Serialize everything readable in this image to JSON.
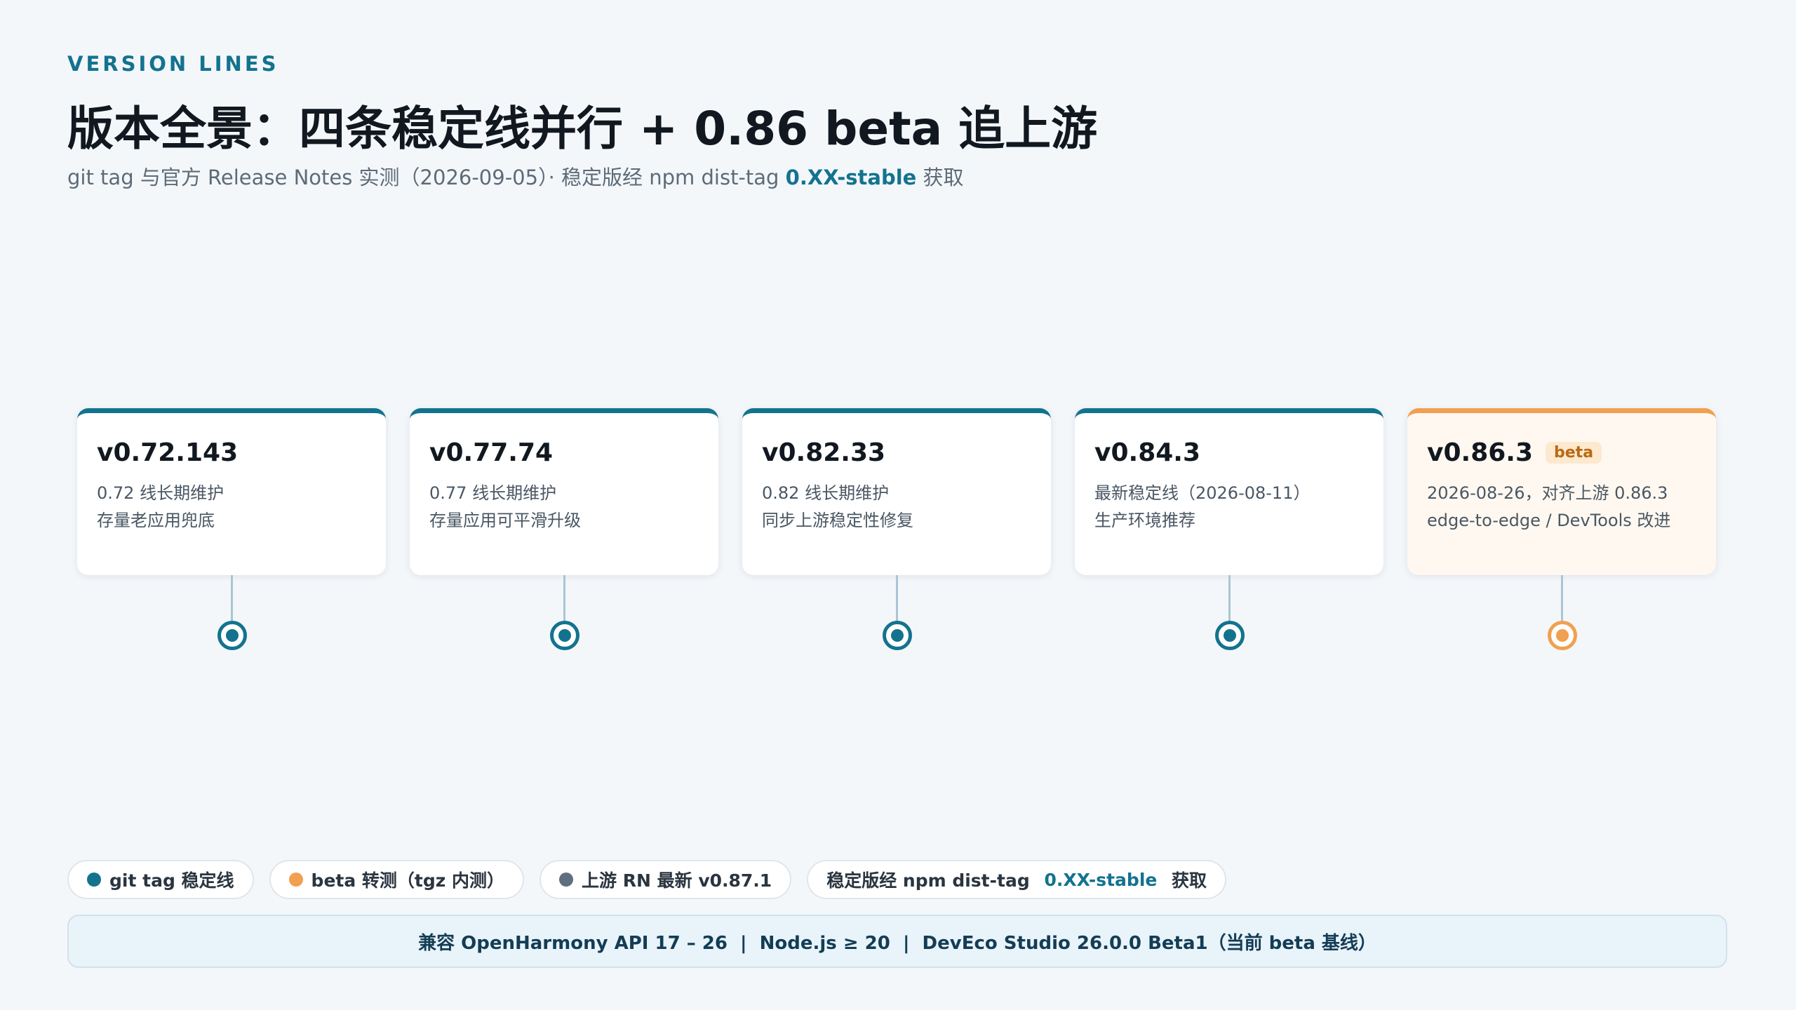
{
  "header": {
    "eyebrow": "VERSION LINES",
    "title": "版本全景：四条稳定线并行 + 0.86 beta 追上游",
    "subtitle_prefix": "git tag 与官方 Release Notes 实测（2026-09-05）· 稳定版经 npm dist-tag ",
    "subtitle_highlight": "0.XX-stable",
    "subtitle_suffix": " 获取"
  },
  "colors": {
    "stable": "#13738f",
    "beta": "#f0a050",
    "upstream": "#5f6f80",
    "track_start": "#c7d9e0",
    "track_end": "#13738f"
  },
  "timeline": {
    "items": [
      {
        "version": "v0.72.143",
        "badge": "",
        "line1": "0.72 线长期维护",
        "line2": "存量老应用兜底",
        "kind": "stable"
      },
      {
        "version": "v0.77.74",
        "badge": "",
        "line1": "0.77 线长期维护",
        "line2": "存量应用可平滑升级",
        "kind": "stable"
      },
      {
        "version": "v0.82.33",
        "badge": "",
        "line1": "0.82 线长期维护",
        "line2": "同步上游稳定性修复",
        "kind": "stable"
      },
      {
        "version": "v0.84.3",
        "badge": "",
        "line1": "最新稳定线（2026-08-11）",
        "line2": "生产环境推荐",
        "kind": "stable"
      },
      {
        "version": "v0.86.3",
        "badge": "beta",
        "line1": "2026-08-26，对齐上游 0.86.3",
        "line2": "edge-to-edge / DevTools 改进",
        "kind": "beta"
      }
    ]
  },
  "legend": {
    "stable": "git tag 稳定线",
    "beta": "beta 转测（tgz 内测）",
    "upstream": "上游 RN 最新 v0.87.1",
    "note_prefix": "稳定版经 npm dist-tag ",
    "note_highlight": "0.XX-stable",
    "note_suffix": " 获取"
  },
  "footer": {
    "compat": "兼容 OpenHarmony API 17 – 26  |  Node.js ≥ 20  |  DevEco Studio 26.0.0 Beta1（当前 beta 基线）"
  }
}
